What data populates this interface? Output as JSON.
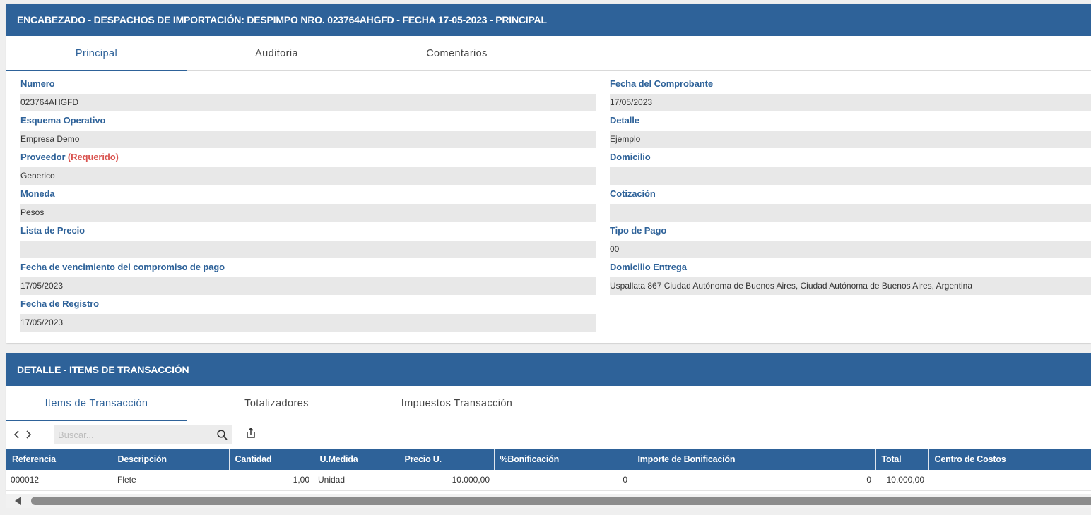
{
  "header": {
    "title": "ENCABEZADO - DESPACHOS DE IMPORTACIÓN: DESPIMPO NRO. 023764AHGFD - FECHA 17-05-2023 - PRINCIPAL"
  },
  "header_tabs": [
    {
      "label": "Principal",
      "active": true
    },
    {
      "label": "Auditoria",
      "active": false
    },
    {
      "label": "Comentarios",
      "active": false
    }
  ],
  "form": {
    "left": [
      {
        "label": "Numero",
        "value": "023764AHGFD"
      },
      {
        "label": "Esquema Operativo",
        "value": "Empresa Demo"
      },
      {
        "label": "Proveedor",
        "required_label": "(Requerido)",
        "value": "Generico"
      },
      {
        "label": "Moneda",
        "value": "Pesos"
      },
      {
        "label": "Lista de Precio",
        "value": ""
      },
      {
        "label": "Fecha de vencimiento del compromiso de pago",
        "value": "17/05/2023"
      },
      {
        "label": "Fecha de Registro",
        "value": "17/05/2023"
      }
    ],
    "right": [
      {
        "label": "Fecha del Comprobante",
        "value": "17/05/2023"
      },
      {
        "label": "Detalle",
        "value": "Ejemplo"
      },
      {
        "label": "Domicilio",
        "value": ""
      },
      {
        "label": "Cotización",
        "value": ""
      },
      {
        "label": "Tipo de Pago",
        "value": "00"
      },
      {
        "label": "Domicilio Entrega",
        "value": "Uspallata 867  Ciudad Autónoma de Buenos Aires, Ciudad Autónoma de Buenos Aires, Argentina"
      }
    ]
  },
  "detail": {
    "title": "DETALLE - ITEMS DE TRANSACCIÓN",
    "tabs": [
      {
        "label": "Items de Transacción",
        "active": true
      },
      {
        "label": "Totalizadores",
        "active": false
      },
      {
        "label": "Impuestos Transacción",
        "active": false
      }
    ],
    "search_placeholder": "Buscar...",
    "columns": [
      "Referencia",
      "Descripción",
      "Cantidad",
      "U.Medida",
      "Precio U.",
      "%Bonificación",
      "Importe de Bonificación",
      "Total",
      "Centro de Costos"
    ],
    "rows": [
      [
        "000012",
        "Flete",
        "1,00",
        "Unidad",
        "10.000,00",
        "0",
        "0",
        "10.000,00",
        ""
      ]
    ]
  },
  "colors": {
    "primary": "#2e6299",
    "required": "#d9534f",
    "field_bg": "#e8e8e8"
  },
  "icons": [
    "chevron-left-icon",
    "chevron-right-icon",
    "search-icon",
    "export-icon",
    "scroll-left-icon"
  ]
}
